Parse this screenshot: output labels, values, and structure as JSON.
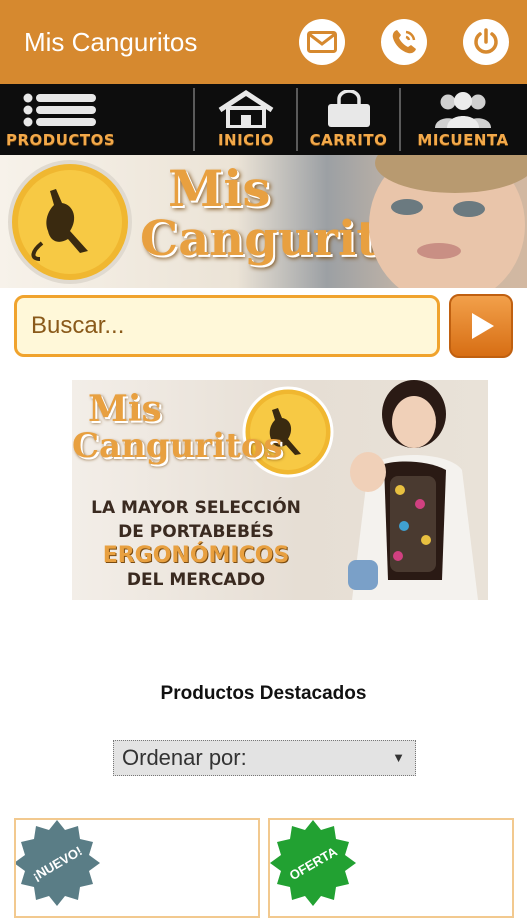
{
  "appbar": {
    "title": "Mis Canguritos",
    "bg_color": "#d6892f",
    "actions": [
      "mail-icon",
      "phone-icon",
      "power-icon"
    ]
  },
  "nav": {
    "items": [
      {
        "label": "PRODUCTOS",
        "icon": "menu-list-icon"
      },
      {
        "label": "INICIO",
        "icon": "home-icon"
      },
      {
        "label": "CARRITO",
        "icon": "shopping-bag-icon"
      },
      {
        "label": "MICUENTA",
        "icon": "account-group-icon"
      }
    ]
  },
  "banner": {
    "logo_text_1": "Mis",
    "logo_text_2": "Canguritos"
  },
  "search": {
    "placeholder": "Buscar..."
  },
  "promo": {
    "logo_text_1": "Mis",
    "logo_text_2": "Canguritos",
    "line1": "LA MAYOR SELECCIÓN",
    "line2": "DE PORTABEBÉS",
    "line3": "ERGONÓMICOS",
    "line4": "DEL MERCADO"
  },
  "featured": {
    "title": "Productos Destacados",
    "sort_label": "Ordenar por:"
  },
  "cards": [
    {
      "badge": "¡NUEVO!",
      "badge_color": "#5a7d86"
    },
    {
      "badge": "OFERTA",
      "badge_color": "#22a132"
    }
  ]
}
